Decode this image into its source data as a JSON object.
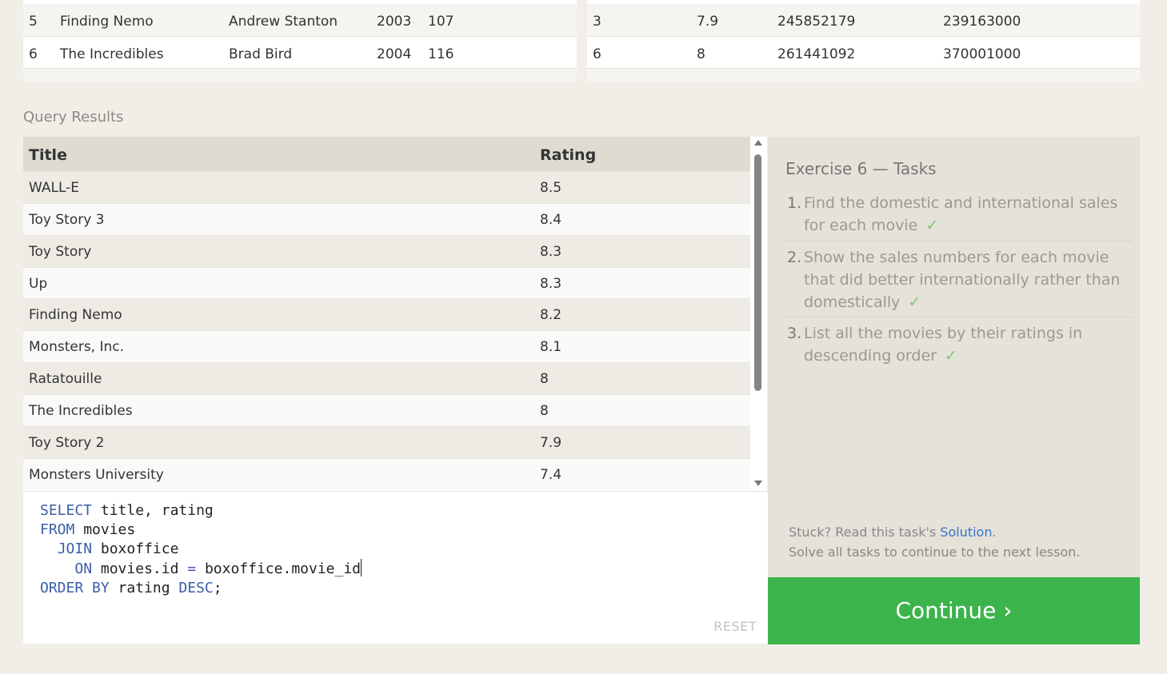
{
  "top_left_rows": [
    {
      "id": "5",
      "title": "Finding Nemo",
      "director": "Andrew Stanton",
      "year": "2003",
      "length": "107"
    },
    {
      "id": "6",
      "title": "The Incredibles",
      "director": "Brad Bird",
      "year": "2004",
      "length": "116"
    }
  ],
  "top_right_rows": [
    {
      "movie_id": "3",
      "rating": "7.9",
      "domestic": "245852179",
      "international": "239163000"
    },
    {
      "movie_id": "6",
      "rating": "8",
      "domestic": "261441092",
      "international": "370001000"
    }
  ],
  "section_title": "Query Results",
  "results": {
    "headers": {
      "title": "Title",
      "rating": "Rating"
    },
    "rows": [
      {
        "title": "WALL-E",
        "rating": "8.5"
      },
      {
        "title": "Toy Story 3",
        "rating": "8.4"
      },
      {
        "title": "Toy Story",
        "rating": "8.3"
      },
      {
        "title": "Up",
        "rating": "8.3"
      },
      {
        "title": "Finding Nemo",
        "rating": "8.2"
      },
      {
        "title": "Monsters, Inc.",
        "rating": "8.1"
      },
      {
        "title": "Ratatouille",
        "rating": "8"
      },
      {
        "title": "The Incredibles",
        "rating": "8"
      },
      {
        "title": "Toy Story 2",
        "rating": "7.9"
      },
      {
        "title": "Monsters University",
        "rating": "7.4"
      }
    ]
  },
  "editor": {
    "reset_label": "RESET"
  },
  "tasks": {
    "title": "Exercise 6 — Tasks",
    "items": [
      {
        "num": "1.",
        "text": "Find the domestic and international sales for each movie",
        "check": "✓"
      },
      {
        "num": "2.",
        "text": "Show the sales numbers for each movie that did better internationally rather than domestically",
        "check": "✓"
      },
      {
        "num": "3.",
        "text": "List all the movies by their ratings in descending order",
        "check": "✓"
      }
    ],
    "stuck_prefix": "Stuck? Read this task's ",
    "solution_link": "Solution",
    "stuck_suffix": ".",
    "solve_all": "Solve all tasks to continue to the next lesson."
  },
  "continue_label": "Continue ›",
  "colors": {
    "accent_green": "#3cb44c",
    "keyword_blue": "#3b5ea8",
    "link_blue": "#3b73c8"
  }
}
